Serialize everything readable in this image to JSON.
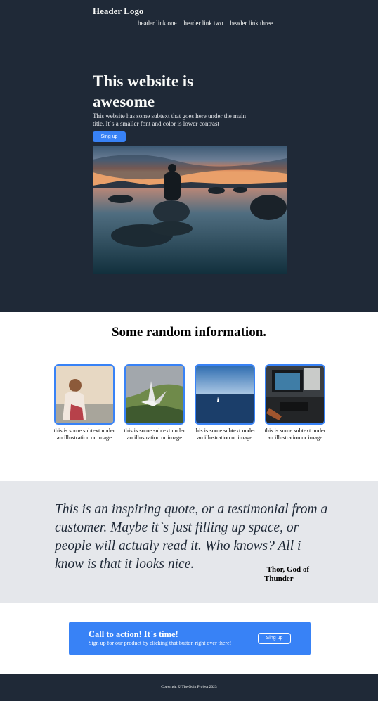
{
  "header": {
    "logo": "Header Logo",
    "links": [
      "header link one",
      "header link two",
      "header link three"
    ]
  },
  "hero": {
    "title": "This website is awesome",
    "subtext": "This website has some subtext that goes here under the main title. It`s a smaller font and color is lower contrast",
    "button_label": "Sing up",
    "image_icon": "landscape-photo-icon"
  },
  "info": {
    "title": "Some random information.",
    "cards": [
      {
        "caption": "this is some subtext under an illustration or image",
        "icon": "woman-photo-icon"
      },
      {
        "caption": "this is some subtext under an illustration or image",
        "icon": "bird-photo-icon"
      },
      {
        "caption": "this is some subtext under an illustration or image",
        "icon": "sea-photo-icon"
      },
      {
        "caption": "this is some subtext under an illustration or image",
        "icon": "desk-photo-icon"
      }
    ]
  },
  "quote": {
    "text": "This is an inspiring quote, or a testimonial from a customer. Maybe it`s just filling up space, or people will actualy read it. Who knows? All i know is that it looks nice.",
    "author": "-Thor, God of Thunder"
  },
  "cta": {
    "title": "Call to action! It`s time!",
    "subtext": "Sign up for our product by clicking that button right over there!",
    "button_label": "Sing up"
  },
  "footer": {
    "copyright": "Copyright © The Odin Project 2023"
  },
  "colors": {
    "dark": "#1f2937",
    "accent": "#3882f6",
    "quote_bg": "#e5e7eb",
    "light_text": "#f9faf8"
  }
}
